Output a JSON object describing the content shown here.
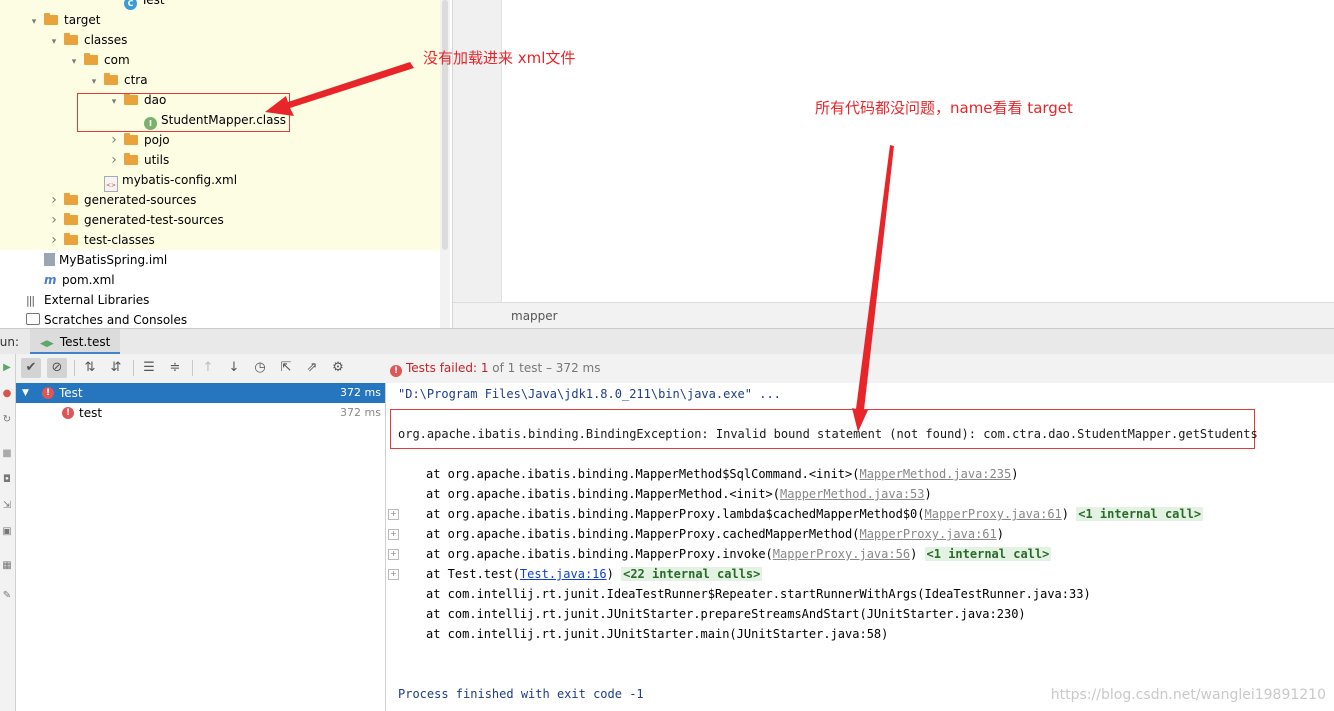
{
  "project_tree": {
    "items": [
      {
        "label": "Test",
        "indent": 5,
        "icon": "class-icon",
        "arrow": ""
      },
      {
        "label": "target",
        "indent": 1,
        "icon": "folder-icon",
        "arrow": "open"
      },
      {
        "label": "classes",
        "indent": 2,
        "icon": "folder-icon",
        "arrow": "open"
      },
      {
        "label": "com",
        "indent": 3,
        "icon": "folder-icon",
        "arrow": "open"
      },
      {
        "label": "ctra",
        "indent": 4,
        "icon": "folder-icon",
        "arrow": "open"
      },
      {
        "label": "dao",
        "indent": 5,
        "icon": "folder-icon",
        "arrow": "open"
      },
      {
        "label": "StudentMapper.class",
        "indent": 6,
        "icon": "interface-icon",
        "arrow": ""
      },
      {
        "label": "pojo",
        "indent": 5,
        "icon": "folder-icon",
        "arrow": "closed"
      },
      {
        "label": "utils",
        "indent": 5,
        "icon": "folder-icon",
        "arrow": "closed"
      },
      {
        "label": "mybatis-config.xml",
        "indent": 4,
        "icon": "xml-file-icon",
        "arrow": ""
      },
      {
        "label": "generated-sources",
        "indent": 2,
        "icon": "folder-icon",
        "arrow": "closed"
      },
      {
        "label": "generated-test-sources",
        "indent": 2,
        "icon": "folder-icon",
        "arrow": "closed"
      },
      {
        "label": "test-classes",
        "indent": 2,
        "icon": "folder-icon",
        "arrow": "closed"
      },
      {
        "label": "MyBatisSpring.iml",
        "indent": 1,
        "icon": "iml-file-icon",
        "arrow": ""
      },
      {
        "label": "pom.xml",
        "indent": 1,
        "icon": "maven-icon",
        "arrow": ""
      },
      {
        "label": "External Libraries",
        "indent": 0,
        "icon": "libraries-icon",
        "arrow": ""
      },
      {
        "label": "Scratches and Consoles",
        "indent": 0,
        "icon": "scratches-icon",
        "arrow": ""
      }
    ]
  },
  "editor": {
    "breadcrumb": "mapper"
  },
  "run_panel": {
    "label": "Run:",
    "tab_label": "Test.test"
  },
  "toolbar": {
    "status_prefix": "Tests failed:",
    "status_count": "1",
    "status_suffix": "of 1 test – 372 ms"
  },
  "test_tree": {
    "root": {
      "label": "Test",
      "duration": "372 ms"
    },
    "child": {
      "label": "test",
      "duration": "372 ms"
    }
  },
  "console": {
    "command_line": "\"D:\\Program Files\\Java\\jdk1.8.0_211\\bin\\java.exe\" ...",
    "exception": "org.apache.ibatis.binding.BindingException: Invalid bound statement (not found): com.ctra.dao.StudentMapper.getStudents",
    "stack": [
      {
        "prefix": "at org.apache.ibatis.binding.MapperMethod$SqlCommand.<init>(",
        "link": "MapperMethod.java:235",
        "suffix": ")",
        "internal": "",
        "fold": false,
        "link_style": "gray"
      },
      {
        "prefix": "at org.apache.ibatis.binding.MapperMethod.<init>(",
        "link": "MapperMethod.java:53",
        "suffix": ")",
        "internal": "",
        "fold": false,
        "link_style": "gray"
      },
      {
        "prefix": "at org.apache.ibatis.binding.MapperProxy.lambda$cachedMapperMethod$0(",
        "link": "MapperProxy.java:61",
        "suffix": ")",
        "internal": "<1 internal call>",
        "fold": true,
        "link_style": "gray"
      },
      {
        "prefix": "at org.apache.ibatis.binding.MapperProxy.cachedMapperMethod(",
        "link": "MapperProxy.java:61",
        "suffix": ")",
        "internal": "",
        "fold": true,
        "link_style": "gray"
      },
      {
        "prefix": "at org.apache.ibatis.binding.MapperProxy.invoke(",
        "link": "MapperProxy.java:56",
        "suffix": ")",
        "internal": "<1 internal call>",
        "fold": true,
        "link_style": "gray"
      },
      {
        "prefix": "at Test.test(",
        "link": "Test.java:16",
        "suffix": ")",
        "internal": "<22 internal calls>",
        "fold": true,
        "link_style": "blue"
      },
      {
        "prefix": "at com.intellij.rt.junit.IdeaTestRunner$Repeater.startRunnerWithArgs(IdeaTestRunner.java:33)",
        "link": "",
        "suffix": "",
        "internal": "",
        "fold": false,
        "link_style": "none"
      },
      {
        "prefix": "at com.intellij.rt.junit.JUnitStarter.prepareStreamsAndStart(JUnitStarter.java:230)",
        "link": "",
        "suffix": "",
        "internal": "",
        "fold": false,
        "link_style": "none"
      },
      {
        "prefix": "at com.intellij.rt.junit.JUnitStarter.main(JUnitStarter.java:58)",
        "link": "",
        "suffix": "",
        "internal": "",
        "fold": false,
        "link_style": "none"
      }
    ],
    "exit_line": "Process finished with exit code -1"
  },
  "annotations": {
    "note_xml": "没有加载进来 xml文件",
    "note_code": "所有代码都没问题，name看看 target",
    "color": "#e8262a"
  },
  "watermark": "https://blog.csdn.net/wanglei19891210"
}
